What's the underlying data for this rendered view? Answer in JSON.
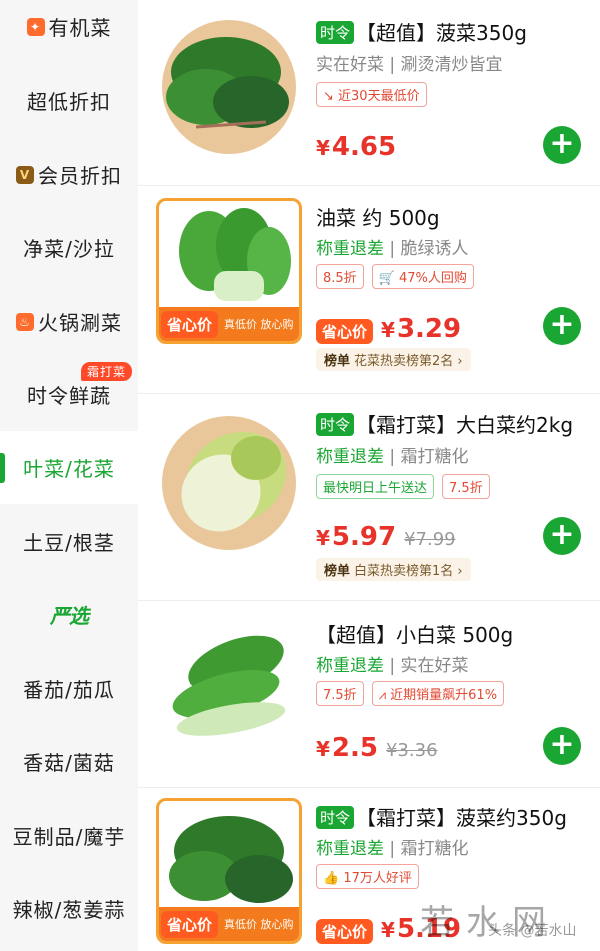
{
  "sidebar": {
    "items": [
      {
        "label": "有机菜",
        "icon": "fire-icon"
      },
      {
        "label": "超低折扣"
      },
      {
        "label": "会员折扣",
        "icon": "vip-icon"
      },
      {
        "label": "净菜/沙拉"
      },
      {
        "label": "火锅涮菜",
        "icon": "hotpot-icon"
      },
      {
        "label": "时令鲜蔬",
        "badge": "霜打菜"
      },
      {
        "label": "叶菜/花菜",
        "active": true
      },
      {
        "label": "土豆/根茎"
      },
      {
        "label": "严选"
      },
      {
        "label": "番茄/茄瓜"
      },
      {
        "label": "香菇/菌菇"
      },
      {
        "label": "豆制品/魔芋"
      },
      {
        "label": "辣椒/葱姜蒜"
      }
    ]
  },
  "products": [
    {
      "seasonal_badge": "时令",
      "title": "【超值】菠菜350g",
      "subtitle": "实在好菜 | 涮烫清炒皆宜",
      "tags": [
        "↘ 近30天最低价"
      ],
      "currency": "¥",
      "price": "4.65"
    },
    {
      "title": "油菜 约 500g",
      "subtitle_green": "称重退差",
      "subtitle_rest": " | 脆绿诱人",
      "tags": [
        "8.5折",
        "🛒 47%人回购"
      ],
      "promo_pill": "省心价",
      "promo_note": "真低价 放心购",
      "currency": "¥",
      "price": "3.29",
      "rank_label": "榜单",
      "rank_text": "花菜热卖榜第2名 ›"
    },
    {
      "seasonal_badge": "时令",
      "title": "【霜打菜】大白菜约2kg",
      "subtitle_green": "称重退差",
      "subtitle_rest": " | 霜打糖化",
      "tags_green": [
        "最快明日上午送达"
      ],
      "tags": [
        "7.5折"
      ],
      "currency": "¥",
      "price": "5.97",
      "old_price": "¥7.99",
      "rank_label": "榜单",
      "rank_text": "白菜热卖榜第1名 ›"
    },
    {
      "title": "【超值】小白菜 500g",
      "subtitle_green": "称重退差",
      "subtitle_rest": " | 实在好菜",
      "tags": [
        "7.5折",
        "近期销量飙升61%"
      ],
      "currency": "¥",
      "price": "2.5",
      "old_price": "¥3.36"
    },
    {
      "seasonal_badge": "时令",
      "title": "【霜打菜】菠菜约350g",
      "subtitle_green": "称重退差",
      "subtitle_rest": " | 霜打糖化",
      "tags": [
        "👍 17万人好评"
      ],
      "promo_pill": "省心价",
      "promo_note": "真低价 放心购",
      "currency": "¥",
      "price": "5.19"
    }
  ],
  "watermark": {
    "big": "若水网",
    "small": "头条 @若水山"
  },
  "colors": {
    "accent_green": "#1aa632",
    "price_red": "#e8332a",
    "promo_orange": "#f37b1d"
  }
}
